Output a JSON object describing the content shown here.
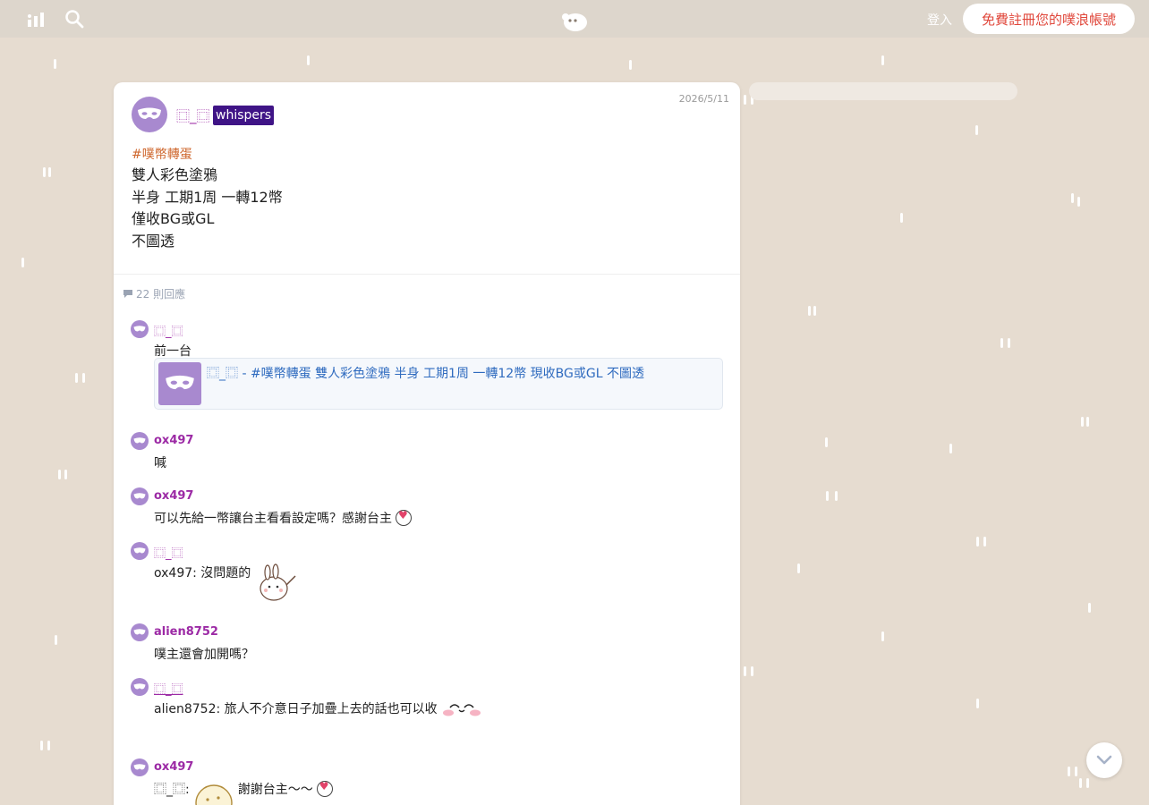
{
  "topbar": {
    "login_label": "登入",
    "signup_label": "免費註冊您的噗浪帳號"
  },
  "post": {
    "author": "⿴_⿴",
    "badge": "whispers",
    "date": "2026/5/11",
    "tag": "#噗幣轉蛋",
    "lines": [
      "雙人彩色塗鴉",
      "半身 工期1周 一轉12幣",
      "僅收BG或GL",
      "不圖透"
    ]
  },
  "responses": {
    "count_label": "22 則回應",
    "items": [
      {
        "name": "⿴_⿴",
        "text": "前一台",
        "link": {
          "author": "⿴_⿴",
          "text": " - #噗幣轉蛋 雙人彩色塗鴉 半身 工期1周 一轉12幣 現收BG或GL 不圖透"
        }
      },
      {
        "name": "ox497",
        "text": "喊"
      },
      {
        "name": "ox497",
        "text": "可以先給一幣讓台主看看設定嗎？感謝台主"
      },
      {
        "name": "⿴_⿴",
        "text": "ox497: 沒問題的"
      },
      {
        "name": "alien8752",
        "text": "噗主還會加開嗎？"
      },
      {
        "name": "⿴_⿴",
        "text": "alien8752: 旅人不介意日子加疊上去的話也可以收"
      },
      {
        "name": "ox497",
        "text": "⿴_⿴:",
        "text2": "謝謝台主〜〜"
      }
    ]
  },
  "colors": {
    "background": "#e6dcd0",
    "topbar": "#ddd6cc",
    "accent_red": "#e0473b",
    "username_purple": "#9c2aa5",
    "whispers_bg": "#3f1486",
    "tag_orange": "#cf682f",
    "link_blue": "#2f6bbf",
    "avatar_purple": "#a889cf"
  },
  "icons": [
    "stats-icon",
    "search-icon",
    "plurk-logo",
    "comment-icon",
    "mask-icon",
    "heart-emoticon",
    "rabbit-sticker",
    "blush-sticker",
    "cookie-sticker",
    "chevron-down-icon"
  ]
}
